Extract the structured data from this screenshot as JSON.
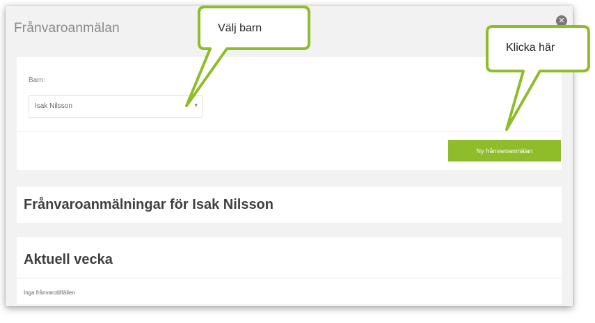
{
  "window": {
    "title": "Frånvaroanmälan",
    "close_icon": "close-icon"
  },
  "filter": {
    "child_label": "Barn:",
    "child_selected": "Isak Nilsson",
    "new_button_label": "Ny frånvaroanmälan",
    "accent_color": "#8fbd2a"
  },
  "list": {
    "heading": "Frånvaroanmälningar för Isak Nilsson",
    "week_heading": "Aktuell vecka",
    "empty_text": "Inga frånvarotillfällen"
  },
  "callouts": {
    "choose_child": "Välj barn",
    "click_here": "Klicka här",
    "border_color": "#8fbd2a"
  }
}
